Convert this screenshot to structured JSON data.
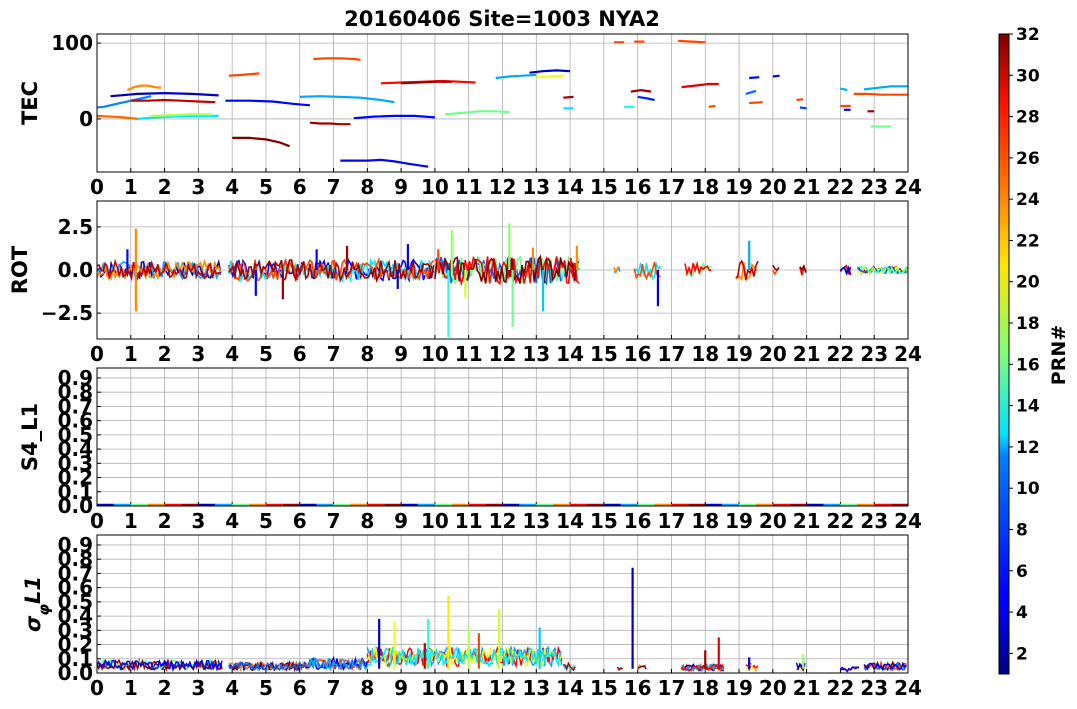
{
  "chart_data": {
    "type": "scatter",
    "title": "20160406 Site=1003 NYA2",
    "x_ticks": [
      "0",
      "1",
      "2",
      "3",
      "4",
      "5",
      "6",
      "7",
      "8",
      "9",
      "10",
      "11",
      "12",
      "13",
      "14",
      "15",
      "16",
      "17",
      "18",
      "19",
      "20",
      "21",
      "22",
      "23",
      "24"
    ],
    "xlim": [
      0,
      24
    ],
    "grid": true,
    "panels": [
      {
        "ylabel": "TEC",
        "ylim": [
          -70,
          112
        ],
        "yticks": [
          "0",
          "100"
        ],
        "series": [
          {
            "prn": 9,
            "x": [
              0.0,
              0.2,
              0.5,
              0.8,
              1.1,
              1.3,
              1.6
            ],
            "y": [
              15,
              16,
              19,
              22,
              25,
              27,
              30
            ]
          },
          {
            "prn": 25,
            "x": [
              0.0,
              0.4,
              0.8,
              1.2
            ],
            "y": [
              4,
              3,
              2,
              0
            ]
          },
          {
            "prn": 12,
            "x": [
              1.2,
              1.7,
              2.2,
              2.7,
              3.2,
              3.6
            ],
            "y": [
              0,
              2,
              3,
              4,
              4,
              4
            ]
          },
          {
            "prn": 3,
            "x": [
              0.4,
              1.2,
              2.0,
              2.8,
              3.6
            ],
            "y": [
              30,
              33,
              34,
              33,
              31
            ]
          },
          {
            "prn": 24,
            "x": [
              0.9,
              1.1,
              1.3,
              1.5,
              1.7,
              1.9
            ],
            "y": [
              38,
              42,
              44,
              44,
              42,
              41
            ]
          },
          {
            "prn": 30,
            "x": [
              1.0,
              1.5,
              2.0,
              2.5,
              3.0,
              3.5
            ],
            "y": [
              24,
              24,
              25,
              24,
              23,
              22
            ]
          },
          {
            "prn": 18,
            "x": [
              1.6,
              2.2,
              2.8,
              3.4
            ],
            "y": [
              4,
              5,
              6,
              6
            ]
          },
          {
            "prn": 5,
            "x": [
              3.8,
              4.5,
              5.2,
              5.8,
              6.3
            ],
            "y": [
              24,
              24,
              23,
              20,
              18
            ]
          },
          {
            "prn": 26,
            "x": [
              3.9,
              4.3,
              4.8
            ],
            "y": [
              57,
              58,
              60
            ]
          },
          {
            "prn": 32,
            "x": [
              4.0,
              4.5,
              5.0,
              5.4,
              5.7
            ],
            "y": [
              -25,
              -25,
              -27,
              -31,
              -36
            ]
          },
          {
            "prn": 10,
            "x": [
              6.0,
              6.6,
              7.2,
              7.8,
              8.4,
              8.8
            ],
            "y": [
              29,
              30,
              29,
              28,
              25,
              22
            ]
          },
          {
            "prn": 26,
            "x": [
              6.4,
              6.8,
              7.2,
              7.6,
              7.8
            ],
            "y": [
              79,
              80,
              80,
              79,
              78
            ]
          },
          {
            "prn": 31,
            "x": [
              6.3,
              6.6,
              6.9,
              7.2,
              7.5
            ],
            "y": [
              -5,
              -6,
              -6,
              -7,
              -7
            ]
          },
          {
            "prn": 5,
            "x": [
              7.2,
              7.6,
              8.0,
              8.4,
              8.8,
              9.2,
              9.8
            ],
            "y": [
              -55,
              -55,
              -55,
              -54,
              -56,
              -59,
              -63
            ]
          },
          {
            "prn": 5,
            "x": [
              7.6,
              8.2,
              8.8,
              9.4,
              10.0
            ],
            "y": [
              1,
              3,
              4,
              4,
              2
            ]
          },
          {
            "prn": 28,
            "x": [
              8.4,
              9.0,
              9.6,
              10.2,
              10.8,
              11.2
            ],
            "y": [
              47,
              48,
              49,
              50,
              49,
              48
            ]
          },
          {
            "prn": 31,
            "x": [
              9.0,
              9.5,
              10.0,
              10.5
            ],
            "y": [
              47,
              48,
              49,
              49
            ]
          },
          {
            "prn": 16,
            "x": [
              10.3,
              10.8,
              11.3,
              11.8,
              12.2
            ],
            "y": [
              6,
              8,
              10,
              10,
              9
            ]
          },
          {
            "prn": 10,
            "x": [
              11.8,
              12.2,
              12.6,
              13.0
            ],
            "y": [
              54,
              56,
              57,
              58
            ]
          },
          {
            "prn": 3,
            "x": [
              12.8,
              13.2,
              13.6,
              14.0
            ],
            "y": [
              61,
              63,
              64,
              63
            ]
          },
          {
            "prn": 20,
            "x": [
              13.0,
              13.4,
              13.8
            ],
            "y": [
              55,
              56,
              57
            ]
          },
          {
            "prn": 12,
            "x": [
              13.8,
              14.1
            ],
            "y": [
              14,
              14
            ]
          },
          {
            "prn": 31,
            "x": [
              13.8,
              14.1
            ],
            "y": [
              28,
              29
            ]
          },
          {
            "prn": 26,
            "x": [
              15.3,
              15.6
            ],
            "y": [
              101,
              101
            ]
          },
          {
            "prn": 26,
            "x": [
              15.9,
              16.2
            ],
            "y": [
              102,
              102
            ]
          },
          {
            "prn": 31,
            "x": [
              15.8,
              16.1,
              16.4
            ],
            "y": [
              36,
              38,
              36
            ]
          },
          {
            "prn": 6,
            "x": [
              16.0,
              16.3,
              16.5
            ],
            "y": [
              29,
              27,
              25
            ]
          },
          {
            "prn": 13,
            "x": [
              15.6,
              15.9
            ],
            "y": [
              16,
              16
            ]
          },
          {
            "prn": 26,
            "x": [
              17.2,
              17.6,
              18.0
            ],
            "y": [
              103,
              102,
              101
            ]
          },
          {
            "prn": 29,
            "x": [
              17.3,
              17.7,
              18.1,
              18.4
            ],
            "y": [
              42,
              44,
              46,
              46
            ]
          },
          {
            "prn": 26,
            "x": [
              18.1,
              18.3
            ],
            "y": [
              16,
              17
            ]
          },
          {
            "prn": 8,
            "x": [
              19.2,
              19.5
            ],
            "y": [
              33,
              37
            ]
          },
          {
            "prn": 5,
            "x": [
              19.3,
              19.6
            ],
            "y": [
              54,
              55
            ]
          },
          {
            "prn": 26,
            "x": [
              19.3,
              19.7
            ],
            "y": [
              21,
              22
            ]
          },
          {
            "prn": 5,
            "x": [
              20.0,
              20.2
            ],
            "y": [
              56,
              57
            ]
          },
          {
            "prn": 26,
            "x": [
              20.7,
              20.9
            ],
            "y": [
              25,
              26
            ]
          },
          {
            "prn": 7,
            "x": [
              20.8,
              21.0
            ],
            "y": [
              15,
              14
            ]
          },
          {
            "prn": 10,
            "x": [
              22.0,
              22.2
            ],
            "y": [
              40,
              38
            ]
          },
          {
            "prn": 26,
            "x": [
              22.0,
              22.3
            ],
            "y": [
              17,
              17
            ]
          },
          {
            "prn": 5,
            "x": [
              22.1,
              22.3
            ],
            "y": [
              12,
              12
            ]
          },
          {
            "prn": 10,
            "x": [
              22.7,
              23.1,
              23.5,
              24.0
            ],
            "y": [
              39,
              41,
              43,
              43
            ]
          },
          {
            "prn": 26,
            "x": [
              22.4,
              22.8,
              23.2,
              23.6,
              24.0
            ],
            "y": [
              33,
              33,
              32,
              32,
              32
            ]
          },
          {
            "prn": 16,
            "x": [
              22.9,
              23.2,
              23.5
            ],
            "y": [
              -10,
              -10,
              -10
            ]
          },
          {
            "prn": 31,
            "x": [
              22.8,
              23.0
            ],
            "y": [
              10,
              10
            ]
          }
        ]
      },
      {
        "ylabel": "ROT",
        "ylim": [
          -4.0,
          4.0
        ],
        "yticks": [
          "−2.5",
          "0.0",
          "2.5"
        ],
        "spikes": [
          {
            "prn": 24,
            "x": 1.15,
            "y": 2.4
          },
          {
            "prn": 24,
            "x": 1.15,
            "y": -2.4
          },
          {
            "prn": 5,
            "x": 0.9,
            "y": 1.2
          },
          {
            "prn": 5,
            "x": 4.7,
            "y": -1.5
          },
          {
            "prn": 5,
            "x": 6.5,
            "y": 1.2
          },
          {
            "prn": 5,
            "x": 9.2,
            "y": 1.5
          },
          {
            "prn": 31,
            "x": 5.5,
            "y": -1.7
          },
          {
            "prn": 31,
            "x": 7.4,
            "y": 1.4
          },
          {
            "prn": 17,
            "x": 10.5,
            "y": 2.3
          },
          {
            "prn": 14,
            "x": 10.4,
            "y": -3.9
          },
          {
            "prn": 19,
            "x": 10.9,
            "y": -1.6
          },
          {
            "prn": 17,
            "x": 12.2,
            "y": 2.7
          },
          {
            "prn": 16,
            "x": 12.3,
            "y": -3.3
          },
          {
            "prn": 24,
            "x": 12.9,
            "y": 1.3
          },
          {
            "prn": 11,
            "x": 13.2,
            "y": -2.4
          },
          {
            "prn": 24,
            "x": 14.2,
            "y": 1.4
          },
          {
            "prn": 4,
            "x": 16.6,
            "y": -2.1
          },
          {
            "prn": 10,
            "x": 19.3,
            "y": 1.7
          },
          {
            "prn": 3,
            "x": 8.9,
            "y": -1.1
          },
          {
            "prn": 26,
            "x": 10.1,
            "y": 1.2
          }
        ],
        "segments": [
          {
            "from": 0.0,
            "to": 3.7,
            "amp": 0.5
          },
          {
            "from": 3.9,
            "to": 10.0,
            "amp": 0.6
          },
          {
            "from": 10.0,
            "to": 14.3,
            "amp": 0.8
          },
          {
            "from": 15.3,
            "to": 15.5,
            "amp": 0.2
          },
          {
            "from": 15.9,
            "to": 16.7,
            "amp": 0.5
          },
          {
            "from": 17.4,
            "to": 18.2,
            "amp": 0.4
          },
          {
            "from": 18.9,
            "to": 19.6,
            "amp": 0.6
          },
          {
            "from": 20.0,
            "to": 20.2,
            "amp": 0.3
          },
          {
            "from": 20.8,
            "to": 21.0,
            "amp": 0.3
          },
          {
            "from": 22.0,
            "to": 22.3,
            "amp": 0.3
          },
          {
            "from": 22.5,
            "to": 24.0,
            "amp": 0.2
          }
        ]
      },
      {
        "ylabel": "S4_L1",
        "ylim": [
          0.0,
          0.97
        ],
        "yticks": [
          "0.0",
          "0.1",
          "0.2",
          "0.3",
          "0.4",
          "0.5",
          "0.6",
          "0.7",
          "0.8",
          "0.9"
        ],
        "baseline": 0.0
      },
      {
        "ylabel": "σ_φL1",
        "ylim": [
          0.0,
          0.97
        ],
        "yticks": [
          "0.0",
          "0.1",
          "0.2",
          "0.3",
          "0.4",
          "0.5",
          "0.6",
          "0.7",
          "0.8",
          "0.9"
        ],
        "spikes": [
          {
            "prn": 4,
            "x": 8.35,
            "y": 0.38
          },
          {
            "prn": 20,
            "x": 8.8,
            "y": 0.36
          },
          {
            "prn": 14,
            "x": 9.8,
            "y": 0.38
          },
          {
            "prn": 21,
            "x": 10.4,
            "y": 0.54
          },
          {
            "prn": 18,
            "x": 11.0,
            "y": 0.33
          },
          {
            "prn": 19,
            "x": 11.9,
            "y": 0.45
          },
          {
            "prn": 11,
            "x": 13.1,
            "y": 0.32
          },
          {
            "prn": 3,
            "x": 15.85,
            "y": 0.74
          },
          {
            "prn": 29,
            "x": 18.4,
            "y": 0.25
          },
          {
            "prn": 31,
            "x": 18.0,
            "y": 0.16
          },
          {
            "prn": 26,
            "x": 11.3,
            "y": 0.28
          },
          {
            "prn": 30,
            "x": 9.7,
            "y": 0.21
          },
          {
            "prn": 17,
            "x": 20.9,
            "y": 0.13
          },
          {
            "prn": 4,
            "x": 19.3,
            "y": 0.11
          }
        ],
        "segments": [
          {
            "from": 0.0,
            "to": 3.7,
            "base": 0.06
          },
          {
            "from": 3.9,
            "to": 6.2,
            "base": 0.05
          },
          {
            "from": 6.2,
            "to": 8.0,
            "base": 0.07
          },
          {
            "from": 8.0,
            "to": 13.8,
            "base": 0.12
          },
          {
            "from": 13.8,
            "to": 14.2,
            "base": 0.05
          },
          {
            "from": 15.4,
            "to": 15.6,
            "base": 0.03
          },
          {
            "from": 16.0,
            "to": 16.3,
            "base": 0.04
          },
          {
            "from": 17.3,
            "to": 18.6,
            "base": 0.04
          },
          {
            "from": 19.2,
            "to": 19.6,
            "base": 0.05
          },
          {
            "from": 20.7,
            "to": 21.0,
            "base": 0.05
          },
          {
            "from": 22.0,
            "to": 22.6,
            "base": 0.03
          },
          {
            "from": 22.7,
            "to": 24.0,
            "base": 0.05
          }
        ]
      }
    ],
    "colorbar": {
      "label": "PRN#",
      "range": [
        1,
        32
      ],
      "ticks": [
        "2",
        "4",
        "6",
        "8",
        "10",
        "12",
        "14",
        "16",
        "18",
        "20",
        "22",
        "24",
        "26",
        "28",
        "30",
        "32"
      ],
      "colormap": "jet"
    }
  }
}
